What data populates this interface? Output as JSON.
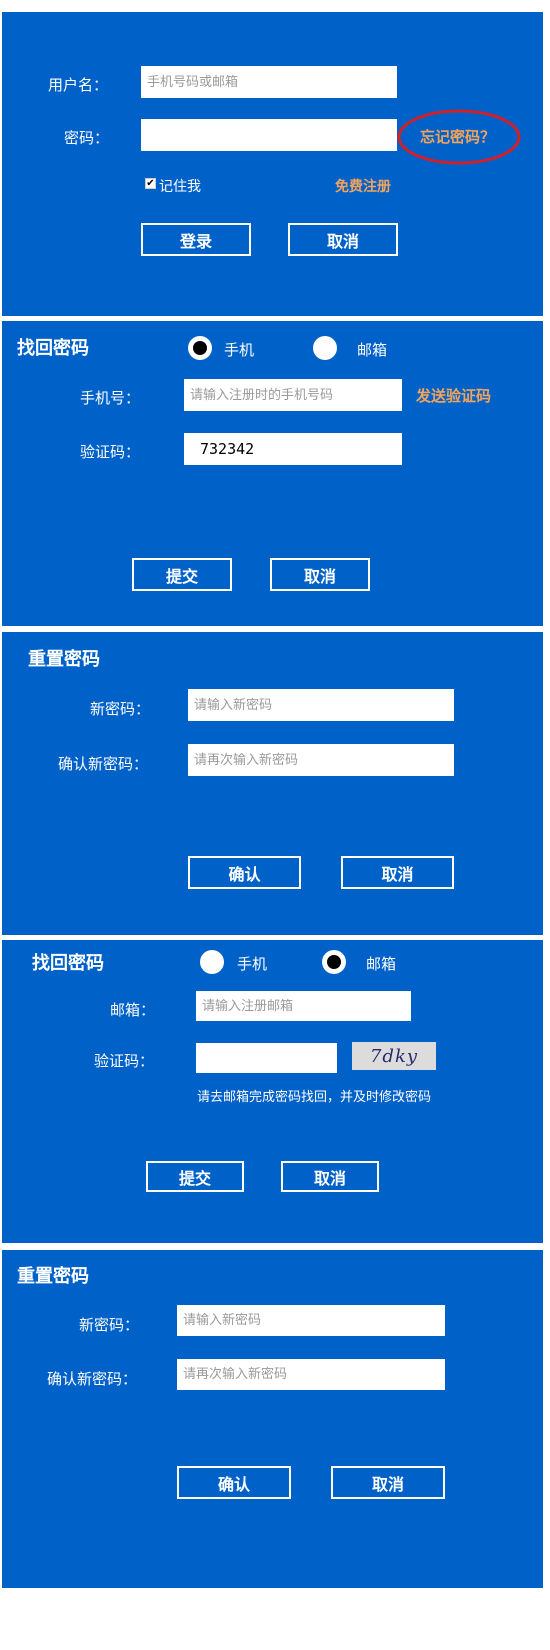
{
  "login": {
    "username_label": "用户名：",
    "username_placeholder": "手机号码或邮箱",
    "password_label": "密码：",
    "forgot_link": "忘记密码？",
    "remember_label": "记住我",
    "remember_checked": true,
    "register_link": "免费注册",
    "login_button": "登录",
    "cancel_button": "取消"
  },
  "recover_phone": {
    "title": "找回密码",
    "radio_phone": "手机",
    "radio_email": "邮箱",
    "selected": "手机",
    "phone_label": "手机号：",
    "phone_placeholder": "请输入注册时的手机号码",
    "send_code_link": "发送验证码",
    "code_label": "验证码：",
    "code_value": "732342",
    "submit_button": "提交",
    "cancel_button": "取消"
  },
  "reset_1": {
    "title": "重置密码",
    "new_pwd_label": "新密码：",
    "new_pwd_placeholder": "请输入新密码",
    "confirm_pwd_label": "确认新密码：",
    "confirm_pwd_placeholder": "请再次输入新密码",
    "confirm_button": "确认",
    "cancel_button": "取消"
  },
  "recover_email": {
    "title": "找回密码",
    "radio_phone": "手机",
    "radio_email": "邮箱",
    "selected": "邮箱",
    "email_label": "邮箱：",
    "email_placeholder": "请输入注册邮箱",
    "code_label": "验证码：",
    "captcha_text": "7dky",
    "hint": "请去邮箱完成密码找回，并及时修改密码",
    "submit_button": "提交",
    "cancel_button": "取消"
  },
  "reset_2": {
    "title": "重置密码",
    "new_pwd_label": "新密码：",
    "new_pwd_placeholder": "请输入新密码",
    "confirm_pwd_label": "确认新密码：",
    "confirm_pwd_placeholder": "请再次输入新密码",
    "confirm_button": "确认",
    "cancel_button": "取消"
  },
  "colors": {
    "panel_bg": "#0062c8",
    "link_orange": "#f3a45a",
    "highlight_red": "#d0202a"
  }
}
